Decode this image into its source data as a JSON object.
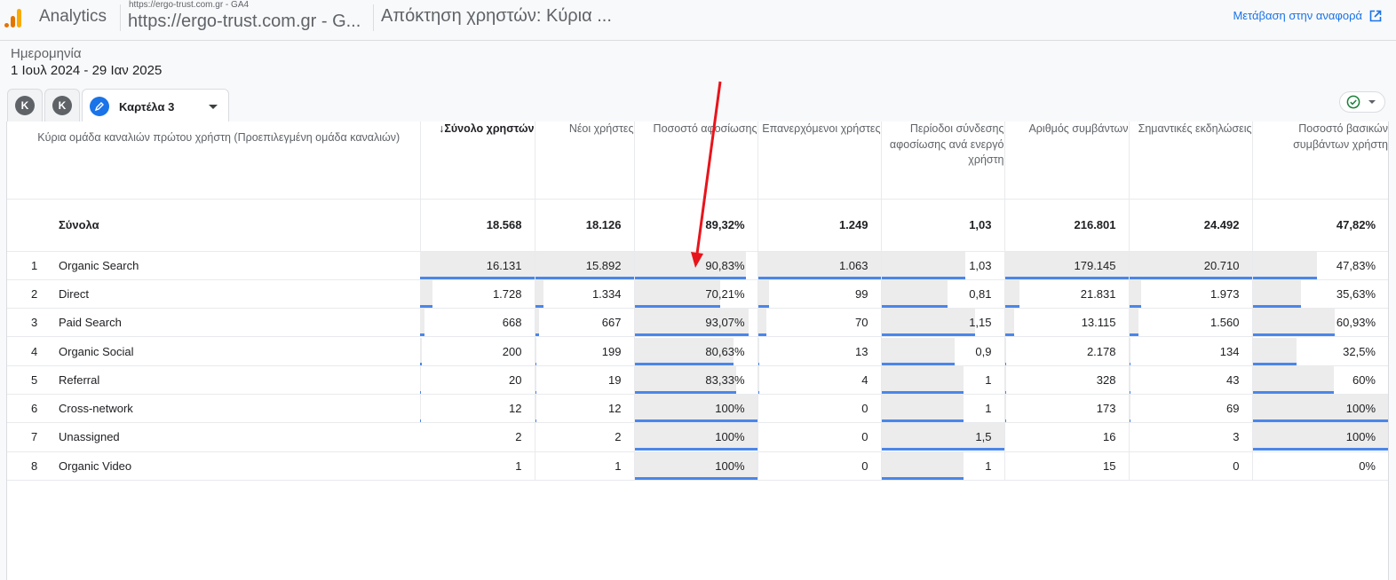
{
  "header": {
    "app_name": "Analytics",
    "property_small": "https://ergo-trust.com.gr - GA4",
    "property_name": "https://ergo-trust.com.gr - G...",
    "report_title": "Απόκτηση χρηστών: Κύρια ...",
    "goto_report_label": "Μετάβαση στην αναφορά",
    "goto_report_icon": "open-in-new-icon"
  },
  "date": {
    "label": "Ημερομηνία",
    "range": "1 Ιουλ 2024 - 29 Ιαν 2025"
  },
  "tabs": [
    {
      "label": "K",
      "type": "avatar"
    },
    {
      "label": "K",
      "type": "avatar"
    },
    {
      "label": "Καρτέλα 3",
      "type": "active",
      "icon": "pencil-icon"
    }
  ],
  "status_chip": {
    "icon": "check-circle-icon",
    "color": "#188038"
  },
  "colors": {
    "accent": "#1a73e8",
    "bar_line": "#4a86e8",
    "bar_fill": "#ececec",
    "annotation_arrow": "#e8141b"
  },
  "table": {
    "dimension_header": "Κύρια ομάδα καναλιών πρώτου χρήστη (Προεπιλεγμένη ομάδα καναλιών)",
    "sort_indicator": "↓",
    "columns": [
      {
        "label": "Σύνολο χρηστών",
        "sorted": true
      },
      {
        "label": "Νέοι χρήστες"
      },
      {
        "label": "Ποσοστό αφοσίωσης"
      },
      {
        "label": "Επανερχόμενοι χρήστες"
      },
      {
        "label": "Περίοδοι σύνδεσης αφοσίωσης ανά ενεργό χρήστη"
      },
      {
        "label": "Αριθμός συμβάντων"
      },
      {
        "label": "Σημαντικές εκδηλώσεις"
      },
      {
        "label": "Ποσοστό βασικών συμβάντων χρήστη"
      }
    ],
    "totals": {
      "label": "Σύνολα",
      "values": [
        "18.568",
        "18.126",
        "89,32%",
        "1.249",
        "1,03",
        "216.801",
        "24.492",
        "47,82%"
      ]
    },
    "rows": [
      {
        "index": "1",
        "name": "Organic Search",
        "values": [
          "16.131",
          "15.892",
          "90,83%",
          "1.063",
          "1,03",
          "179.145",
          "20.710",
          "47,83%"
        ],
        "bars": [
          1.0,
          1.0,
          0.9083,
          1.0,
          0.687,
          1.0,
          1.0,
          0.4783
        ]
      },
      {
        "index": "2",
        "name": "Direct",
        "values": [
          "1.728",
          "1.334",
          "70,21%",
          "99",
          "0,81",
          "21.831",
          "1.973",
          "35,63%"
        ],
        "bars": [
          0.107,
          0.084,
          0.7021,
          0.093,
          0.54,
          0.122,
          0.095,
          0.3563
        ]
      },
      {
        "index": "3",
        "name": "Paid Search",
        "values": [
          "668",
          "667",
          "93,07%",
          "70",
          "1,15",
          "13.115",
          "1.560",
          "60,93%"
        ],
        "bars": [
          0.041,
          0.042,
          0.9307,
          0.066,
          0.767,
          0.073,
          0.075,
          0.6093
        ]
      },
      {
        "index": "4",
        "name": "Organic Social",
        "values": [
          "200",
          "199",
          "80,63%",
          "13",
          "0,9",
          "2.178",
          "134",
          "32,5%"
        ],
        "bars": [
          0.012,
          0.013,
          0.8063,
          0.012,
          0.6,
          0.012,
          0.006,
          0.325
        ]
      },
      {
        "index": "5",
        "name": "Referral",
        "values": [
          "20",
          "19",
          "83,33%",
          "4",
          "1",
          "328",
          "43",
          "60%"
        ],
        "bars": [
          0.001,
          0.001,
          0.8333,
          0.004,
          0.667,
          0.002,
          0.002,
          0.6
        ]
      },
      {
        "index": "6",
        "name": "Cross-network",
        "values": [
          "12",
          "12",
          "100%",
          "0",
          "1",
          "173",
          "69",
          "100%"
        ],
        "bars": [
          0.001,
          0.001,
          1.0,
          0,
          0.667,
          0.001,
          0.003,
          1.0
        ]
      },
      {
        "index": "7",
        "name": "Unassigned",
        "values": [
          "2",
          "2",
          "100%",
          "0",
          "1,5",
          "16",
          "3",
          "100%"
        ],
        "bars": [
          0,
          0,
          1.0,
          0,
          1.0,
          0,
          0,
          1.0
        ]
      },
      {
        "index": "8",
        "name": "Organic Video",
        "values": [
          "1",
          "1",
          "100%",
          "0",
          "1",
          "15",
          "0",
          "0%"
        ],
        "bars": [
          0,
          0,
          1.0,
          0,
          0.667,
          0,
          0,
          0
        ]
      }
    ]
  }
}
